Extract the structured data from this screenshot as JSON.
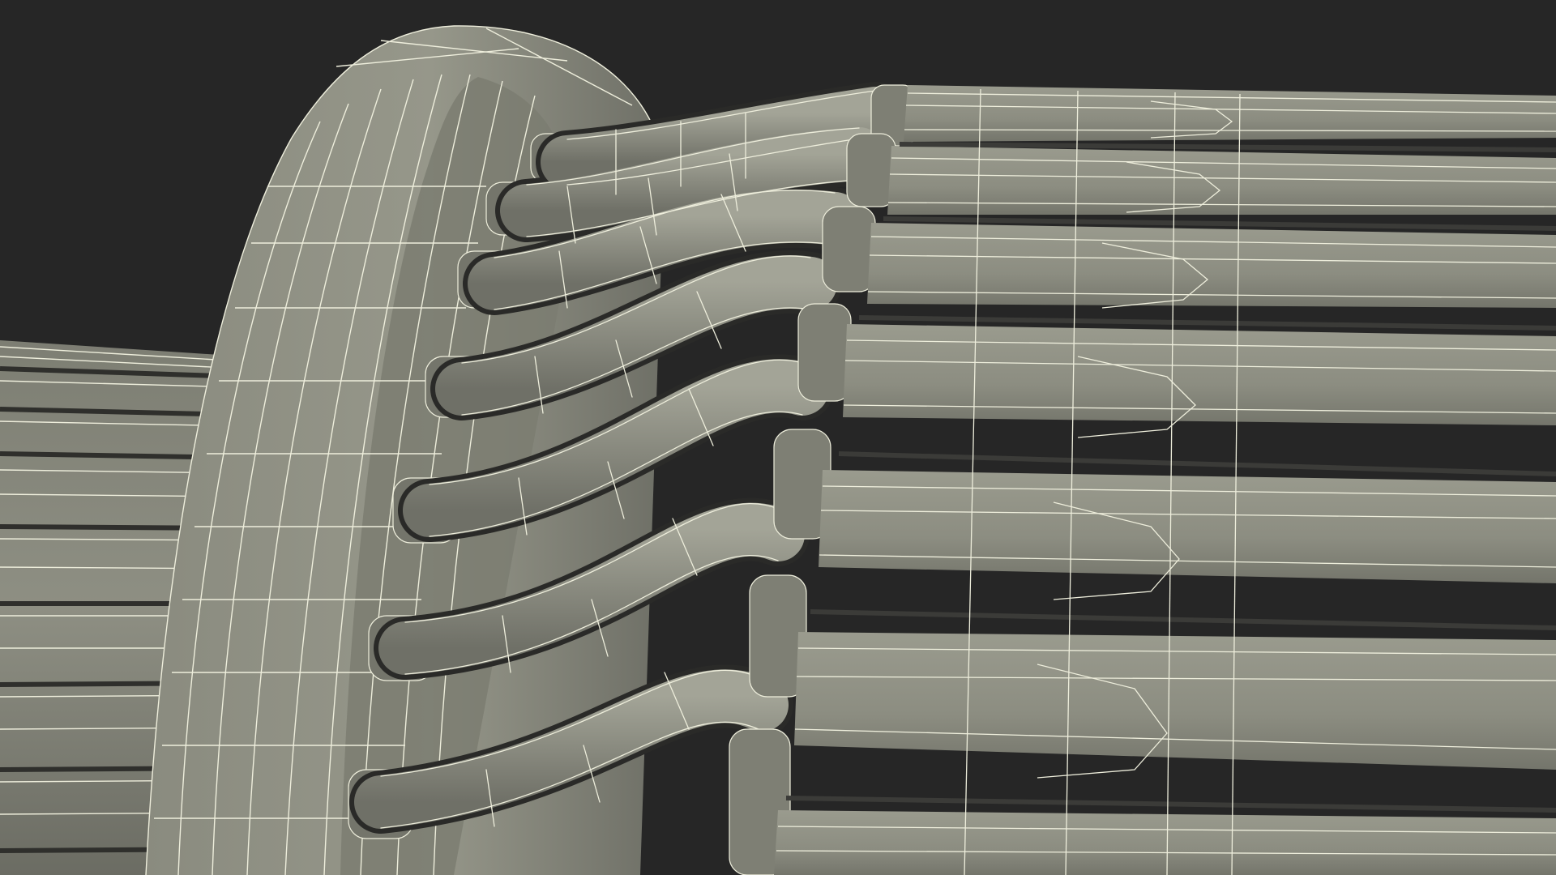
{
  "scene": {
    "subject": "wireframe-render-rotor-winding-detail",
    "colors": {
      "background": "#262626",
      "surface": "#8b8c80",
      "surface_light": "#a2a396",
      "surface_dark": "#5f6058",
      "shadow": "#2c2c2a",
      "wire": "#eeeedc"
    }
  }
}
